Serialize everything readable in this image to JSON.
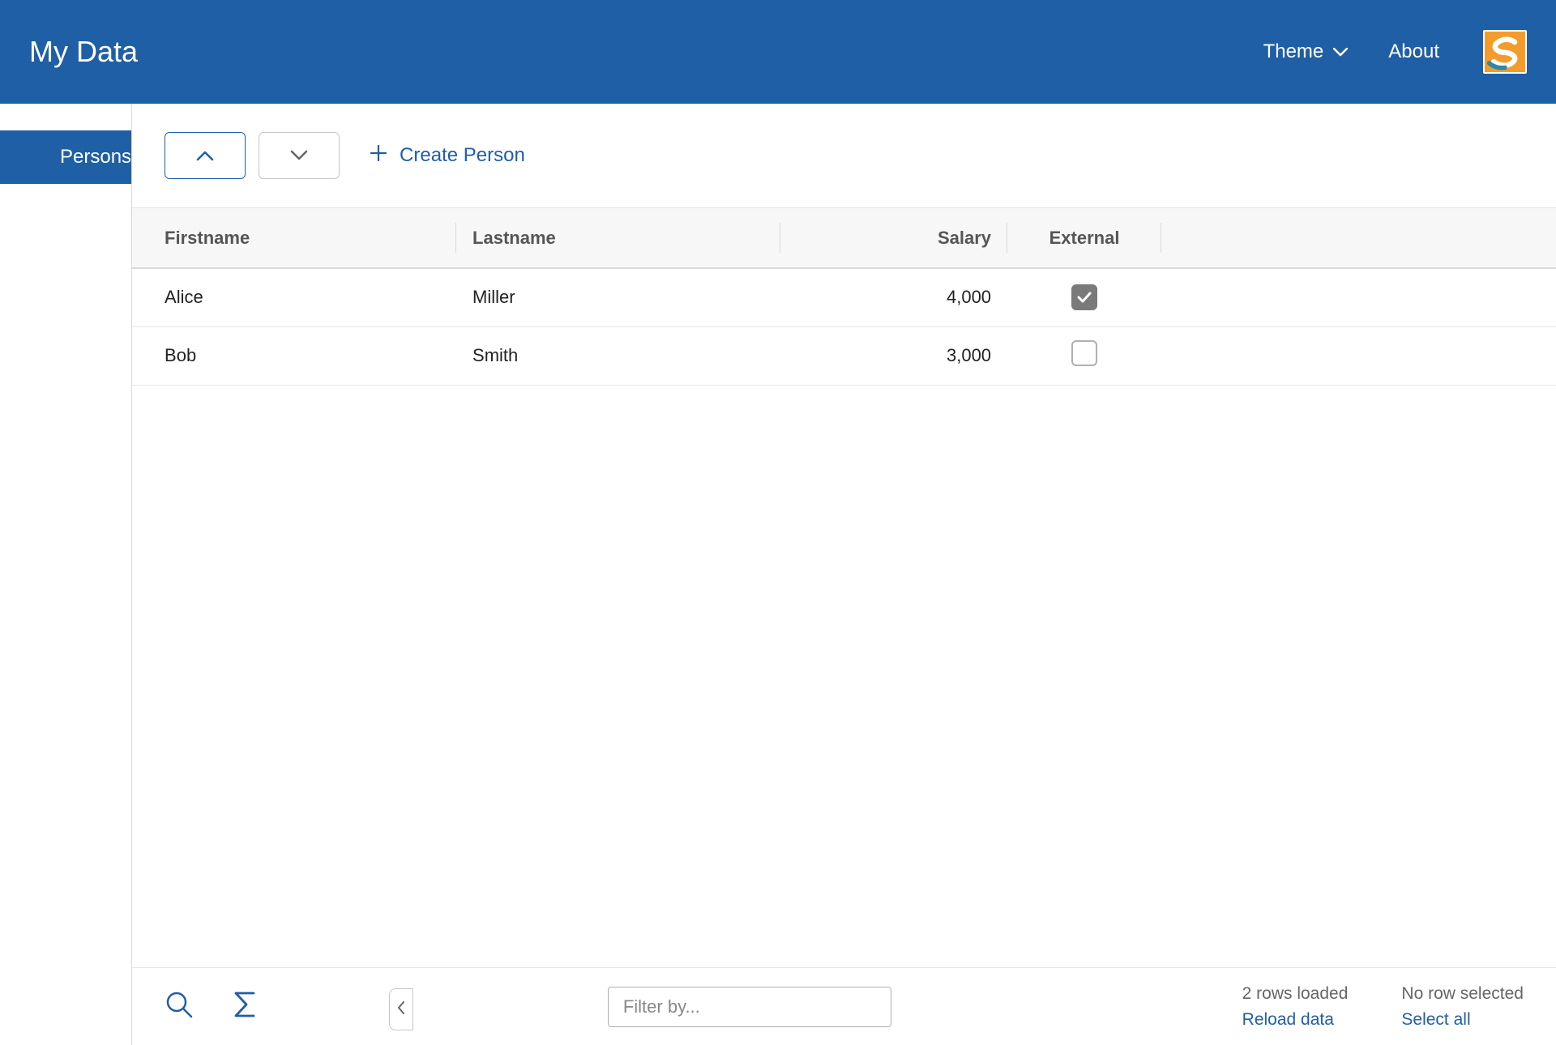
{
  "header": {
    "title": "My Data",
    "theme_label": "Theme",
    "about_label": "About"
  },
  "sidebar": {
    "items": [
      {
        "label": "Persons"
      }
    ]
  },
  "toolbar": {
    "create_label": "Create Person"
  },
  "table": {
    "columns": {
      "firstname": "Firstname",
      "lastname": "Lastname",
      "salary": "Salary",
      "external": "External"
    },
    "rows": [
      {
        "firstname": "Alice",
        "lastname": "Miller",
        "salary": "4,000",
        "external": true
      },
      {
        "firstname": "Bob",
        "lastname": "Smith",
        "salary": "3,000",
        "external": false
      }
    ]
  },
  "footer": {
    "filter_placeholder": "Filter by...",
    "rows_loaded": "2 rows loaded",
    "reload": "Reload data",
    "selection": "No row selected",
    "select_all": "Select all"
  },
  "colors": {
    "brand": "#1F5FA6",
    "accent": "#F39C2C"
  }
}
